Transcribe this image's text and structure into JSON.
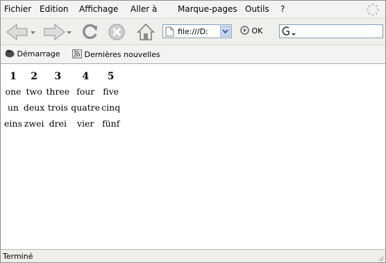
{
  "menu": [
    "Fichier",
    "Edition",
    "Affichage",
    "Aller à",
    "Marque-pages",
    "Outils",
    "?"
  ],
  "toolbar": {
    "url": "file:///D:",
    "go_label": "OK",
    "search_placeholder": ""
  },
  "bookmarks": [
    "Démarrage",
    "Dernières nouvelles"
  ],
  "table": {
    "headers": [
      "1",
      "2",
      "3",
      "4",
      "5"
    ],
    "rows": [
      [
        "one",
        "two",
        "three",
        "four",
        "five"
      ],
      [
        "un",
        "deux",
        "trois",
        "quatre",
        "cinq"
      ],
      [
        "eins",
        "zwei",
        "drei",
        "vier",
        "fünf"
      ]
    ]
  },
  "status": "Terminé",
  "colors": {
    "field_border": "#7f9db9",
    "content_bg": "#ffffff",
    "chrome_bg": "#f1f1ef"
  }
}
